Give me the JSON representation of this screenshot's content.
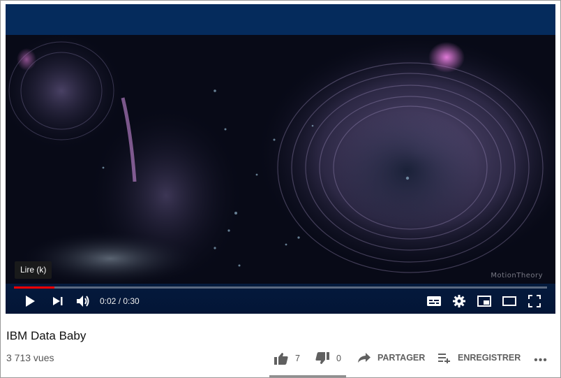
{
  "player": {
    "watermark": "MotionTheory",
    "tooltip": "Lire (k)",
    "current_time": "0:02",
    "duration": "0:30",
    "time_separator": " / ",
    "progress_fraction": 0.076,
    "progress_color": "#ff0000",
    "controls": [
      "play-icon",
      "next-icon",
      "volume-icon",
      "subtitles-icon",
      "settings-icon",
      "miniplayer-icon",
      "theater-icon",
      "fullscreen-icon"
    ]
  },
  "video": {
    "title": "IBM Data Baby",
    "views": "3 713 vues"
  },
  "actions": {
    "like_count": "7",
    "dislike_count": "0",
    "share_label": "PARTAGER",
    "save_label": "ENREGISTRER",
    "more_label": "•••"
  }
}
